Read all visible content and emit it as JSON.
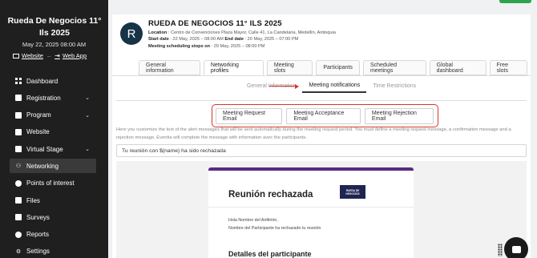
{
  "sidebar": {
    "event_title": "Rueda De Negocios 11° Ils 2025",
    "event_datetime": "May 22, 2025 08:00 AM",
    "links": {
      "website": "Website",
      "webapp": "Web App",
      "separator": "–"
    },
    "items": [
      {
        "label": "Dashboard",
        "icon": "dashboard-icon",
        "expandable": false
      },
      {
        "label": "Registration",
        "icon": "registration-icon",
        "expandable": true
      },
      {
        "label": "Program",
        "icon": "program-icon",
        "expandable": true
      },
      {
        "label": "Website",
        "icon": "website-icon",
        "expandable": false
      },
      {
        "label": "Virtual Stage",
        "icon": "virtual-stage-icon",
        "expandable": true
      },
      {
        "label": "Networking",
        "icon": "networking-icon",
        "expandable": false,
        "active": true
      },
      {
        "label": "Points of interest",
        "icon": "location-pin-icon",
        "expandable": false
      },
      {
        "label": "Files",
        "icon": "folder-icon",
        "expandable": false
      },
      {
        "label": "Surveys",
        "icon": "clipboard-icon",
        "expandable": false
      },
      {
        "label": "Reports",
        "icon": "chart-pie-icon",
        "expandable": false
      },
      {
        "label": "Settings",
        "icon": "gear-icon",
        "expandable": false
      }
    ],
    "chevron": "⌄"
  },
  "header": {
    "avatar_letter": "R",
    "title": "RUEDA DE NEGOCIOS 11° ILS 2025",
    "location_label": "Location",
    "location_value": ": Centro de Convenciones Plaza Mayor, Calle 41, La Candelaria, Medellín, Antioquia",
    "start_label": "Start date",
    "start_value": ": 22 May, 2025 – 08:00 AM",
    "end_label": "End date",
    "end_value": ": 20 May, 2025 – 07:00 PM",
    "stops_label": "Meeting scheduling stops on",
    "stops_value": ": 20 May, 2025 – 08:00 PM"
  },
  "tabs": [
    "General information",
    "Networking profiles",
    "Meeting slots",
    "Participants",
    "Scheduled meetings",
    "Global dashboard",
    "Free slots"
  ],
  "active_tab": "Networking profiles",
  "subtabs": [
    "General information",
    "Meeting notifications",
    "Time Restrictions"
  ],
  "active_subtab": "Meeting notifications",
  "email_buttons": [
    "Meeting Request Email",
    "Meeting Acceptance Email",
    "Meeting Rejection Email"
  ],
  "description": "Here you customize the text of the alert messages that will be sent automatically during the meeting request period. You must define a meeting request message, a confirmation message and a rejection message. Eventia will complete the message with information avec the participants.",
  "subject_value": "Tu reunión con $(name) ha sido rechazada",
  "preview": {
    "title": "Reunión rechazada",
    "logo_text": "RUEDA DE NEGOCIOS",
    "greeting": "Hola Nombre del Anfitrión,",
    "body": "Nombre del Participante ha rechazado tu reunión",
    "section_title": "Detalles del participante"
  },
  "colors": {
    "sidebar_bg": "#1f1f1f",
    "highlight": "#d9342b",
    "email_accent": "#5b2a7f",
    "avatar_bg": "#173447",
    "status_bar": "#2ea44f"
  }
}
